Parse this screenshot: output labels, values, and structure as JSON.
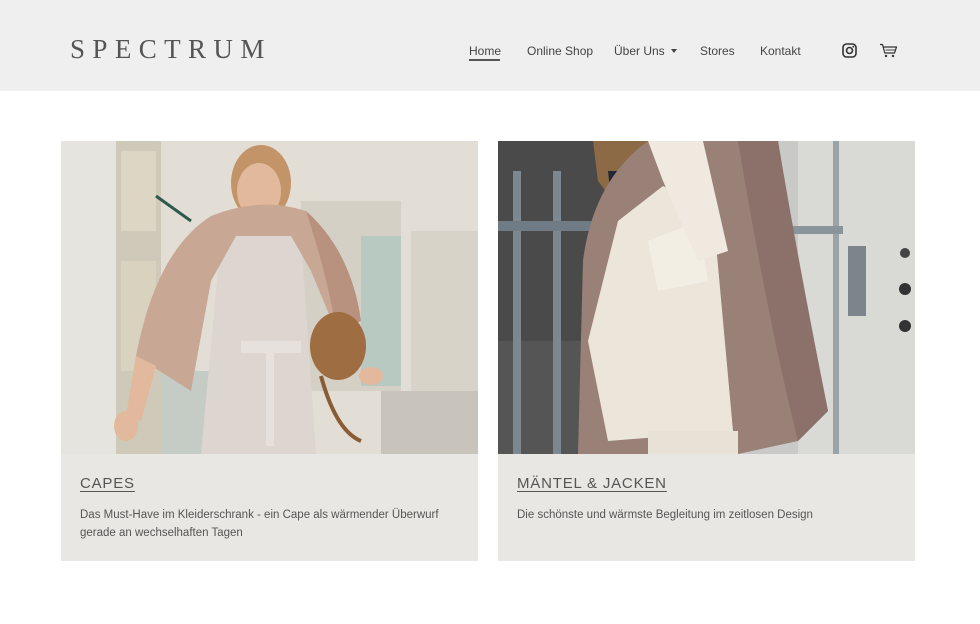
{
  "brand": {
    "logo": "SPECTRUM"
  },
  "nav": {
    "items": [
      "Home",
      "Online Shop",
      "Über Uns",
      "Stores",
      "Kontakt"
    ],
    "active": "Home"
  },
  "icons": {
    "social": "instagram-icon",
    "cart": "shopping-cart-icon"
  },
  "colors": {
    "header_bg": "#efefef",
    "card_bg": "#e9e7e3",
    "text": "#555555"
  },
  "cards": [
    {
      "title": "CAPES",
      "text": "Das Must-Have im Kleiderschrank - ein Cape als wärmender Überwurf gerade an wechselhaften Tagen"
    },
    {
      "title": "MÄNTEL & JACKEN",
      "text": "Die schönste und wärmste Begleitung im zeitlosen Design"
    }
  ]
}
